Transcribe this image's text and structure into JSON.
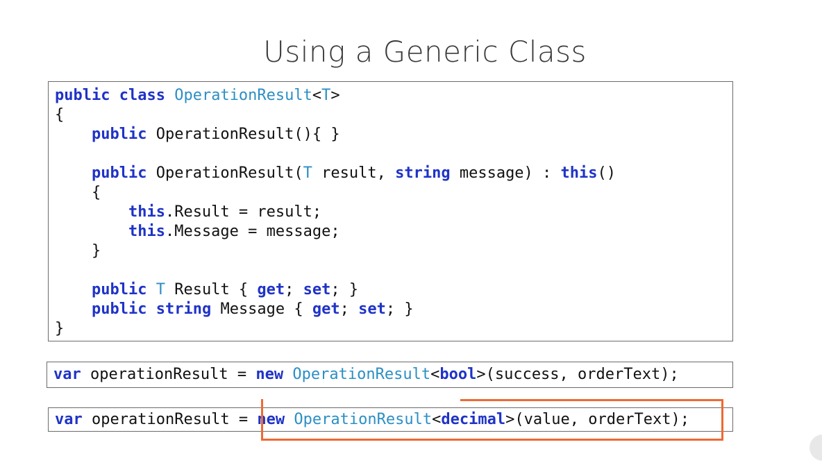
{
  "slide": {
    "title": "Using a Generic Class"
  },
  "colors": {
    "keyword": "#1f33c7",
    "type": "#2b8fc4",
    "plain": "#111111",
    "highlight": "#ee6a32",
    "border": "#6a6a6a"
  },
  "code_main": {
    "lines": [
      [
        {
          "t": "public",
          "k": "kw"
        },
        {
          "t": " ",
          "k": "pl"
        },
        {
          "t": "class",
          "k": "kw"
        },
        {
          "t": " ",
          "k": "pl"
        },
        {
          "t": "OperationResult",
          "k": "ty"
        },
        {
          "t": "<",
          "k": "pl"
        },
        {
          "t": "T",
          "k": "ty"
        },
        {
          "t": ">",
          "k": "pl"
        }
      ],
      [
        {
          "t": "{",
          "k": "pl"
        }
      ],
      [
        {
          "t": "    ",
          "k": "pl"
        },
        {
          "t": "public",
          "k": "kw"
        },
        {
          "t": " OperationResult(){ }",
          "k": "pl"
        }
      ],
      [
        {
          "t": "",
          "k": "pl"
        }
      ],
      [
        {
          "t": "    ",
          "k": "pl"
        },
        {
          "t": "public",
          "k": "kw"
        },
        {
          "t": " OperationResult(",
          "k": "pl"
        },
        {
          "t": "T",
          "k": "ty"
        },
        {
          "t": " result, ",
          "k": "pl"
        },
        {
          "t": "string",
          "k": "kw"
        },
        {
          "t": " message) : ",
          "k": "pl"
        },
        {
          "t": "this",
          "k": "kw"
        },
        {
          "t": "()",
          "k": "pl"
        }
      ],
      [
        {
          "t": "    {",
          "k": "pl"
        }
      ],
      [
        {
          "t": "        ",
          "k": "pl"
        },
        {
          "t": "this",
          "k": "kw"
        },
        {
          "t": ".Result = result;",
          "k": "pl"
        }
      ],
      [
        {
          "t": "        ",
          "k": "pl"
        },
        {
          "t": "this",
          "k": "kw"
        },
        {
          "t": ".Message = message;",
          "k": "pl"
        }
      ],
      [
        {
          "t": "    }",
          "k": "pl"
        }
      ],
      [
        {
          "t": "",
          "k": "pl"
        }
      ],
      [
        {
          "t": "    ",
          "k": "pl"
        },
        {
          "t": "public",
          "k": "kw"
        },
        {
          "t": " ",
          "k": "pl"
        },
        {
          "t": "T",
          "k": "ty"
        },
        {
          "t": " Result { ",
          "k": "pl"
        },
        {
          "t": "get",
          "k": "kw"
        },
        {
          "t": "; ",
          "k": "pl"
        },
        {
          "t": "set",
          "k": "kw"
        },
        {
          "t": "; }",
          "k": "pl"
        }
      ],
      [
        {
          "t": "    ",
          "k": "pl"
        },
        {
          "t": "public",
          "k": "kw"
        },
        {
          "t": " ",
          "k": "pl"
        },
        {
          "t": "string",
          "k": "kw"
        },
        {
          "t": " Message { ",
          "k": "pl"
        },
        {
          "t": "get",
          "k": "kw"
        },
        {
          "t": "; ",
          "k": "pl"
        },
        {
          "t": "set",
          "k": "kw"
        },
        {
          "t": "; }",
          "k": "pl"
        }
      ],
      [
        {
          "t": "}",
          "k": "pl"
        }
      ]
    ]
  },
  "code_bool": {
    "lines": [
      [
        {
          "t": "var",
          "k": "kw"
        },
        {
          "t": " operationResult = ",
          "k": "pl"
        },
        {
          "t": "new",
          "k": "kw"
        },
        {
          "t": " ",
          "k": "pl"
        },
        {
          "t": "OperationResult",
          "k": "ty"
        },
        {
          "t": "<",
          "k": "pl"
        },
        {
          "t": "bool",
          "k": "kw"
        },
        {
          "t": ">(success, orderText);",
          "k": "pl"
        }
      ]
    ]
  },
  "code_decimal": {
    "lines": [
      [
        {
          "t": "var",
          "k": "kw"
        },
        {
          "t": " operationResult = ",
          "k": "pl"
        },
        {
          "t": "new",
          "k": "kw"
        },
        {
          "t": " ",
          "k": "pl"
        },
        {
          "t": "OperationResult",
          "k": "ty"
        },
        {
          "t": "<",
          "k": "pl"
        },
        {
          "t": "decimal",
          "k": "kw"
        },
        {
          "t": ">(value, orderText);",
          "k": "pl"
        }
      ]
    ]
  }
}
